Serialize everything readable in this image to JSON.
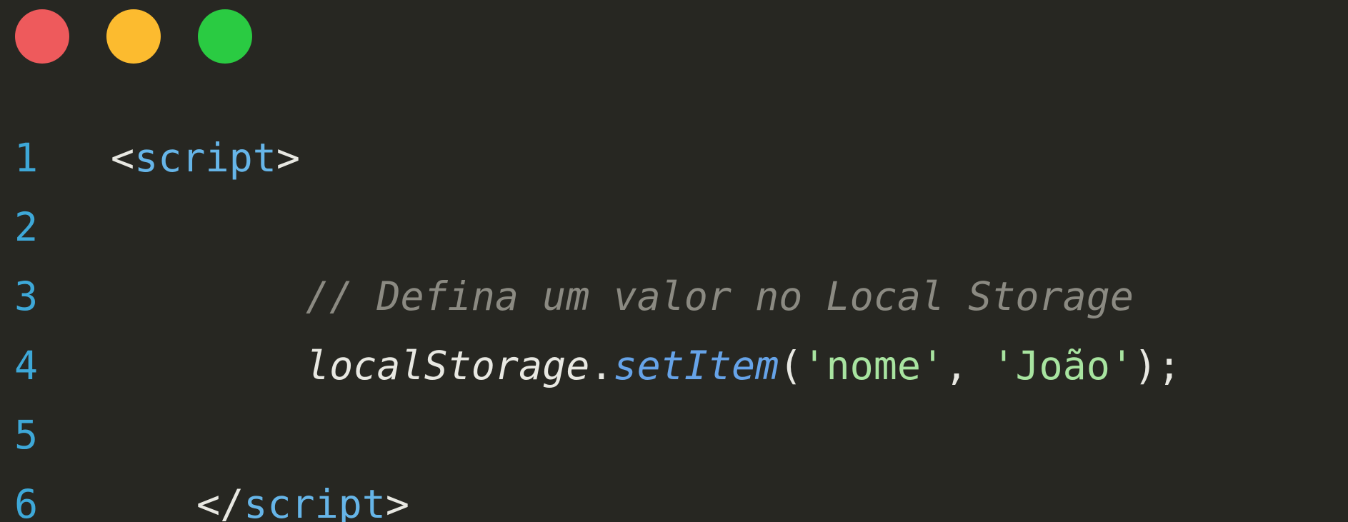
{
  "window": {
    "controls": [
      {
        "name": "close",
        "color": "#ee5a5c"
      },
      {
        "name": "minimize",
        "color": "#fcbb2f"
      },
      {
        "name": "maximize",
        "color": "#2acb42"
      }
    ]
  },
  "editor": {
    "lines": [
      {
        "number": "1",
        "tokens": [
          {
            "text": "<",
            "kind": "punc"
          },
          {
            "text": "script",
            "kind": "tag"
          },
          {
            "text": ">",
            "kind": "punc"
          }
        ]
      },
      {
        "number": "2",
        "tokens": []
      },
      {
        "number": "3",
        "tokens": [
          {
            "text": "// Defina um valor no Local Storage",
            "kind": "comment"
          }
        ]
      },
      {
        "number": "4",
        "tokens": [
          {
            "text": "localStorage",
            "kind": "obj"
          },
          {
            "text": ".",
            "kind": "punc"
          },
          {
            "text": "setItem",
            "kind": "method"
          },
          {
            "text": "(",
            "kind": "punc"
          },
          {
            "text": "'nome'",
            "kind": "string"
          },
          {
            "text": ", ",
            "kind": "punc"
          },
          {
            "text": "'João'",
            "kind": "string"
          },
          {
            "text": ");",
            "kind": "punc"
          }
        ]
      },
      {
        "number": "5",
        "tokens": []
      },
      {
        "number": "6",
        "tokens": [
          {
            "text": "</",
            "kind": "punc"
          },
          {
            "text": "script",
            "kind": "tag"
          },
          {
            "text": ">",
            "kind": "punc"
          }
        ]
      }
    ]
  }
}
